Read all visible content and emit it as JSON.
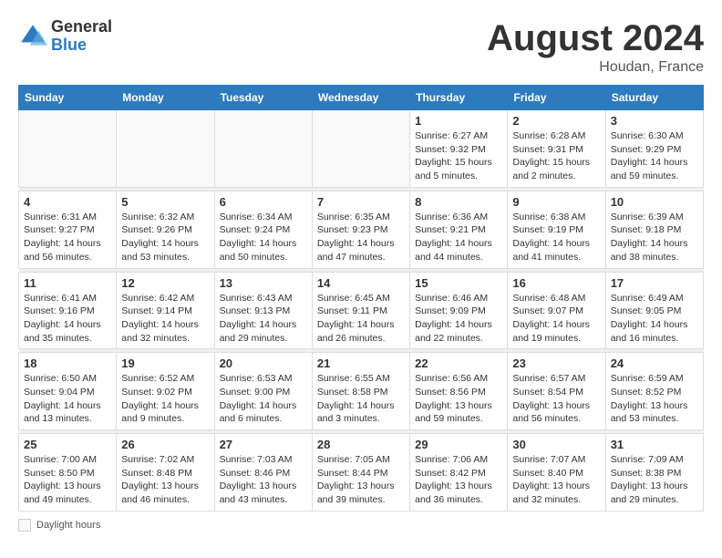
{
  "header": {
    "logo_general": "General",
    "logo_blue": "Blue",
    "title": "August 2024",
    "location": "Houdan, France"
  },
  "days_of_week": [
    "Sunday",
    "Monday",
    "Tuesday",
    "Wednesday",
    "Thursday",
    "Friday",
    "Saturday"
  ],
  "legend": {
    "label": "Daylight hours"
  },
  "weeks": [
    {
      "days": [
        {
          "date": "",
          "info": ""
        },
        {
          "date": "",
          "info": ""
        },
        {
          "date": "",
          "info": ""
        },
        {
          "date": "",
          "info": ""
        },
        {
          "date": "1",
          "info": "Sunrise: 6:27 AM\nSunset: 9:32 PM\nDaylight: 15 hours\nand 5 minutes."
        },
        {
          "date": "2",
          "info": "Sunrise: 6:28 AM\nSunset: 9:31 PM\nDaylight: 15 hours\nand 2 minutes."
        },
        {
          "date": "3",
          "info": "Sunrise: 6:30 AM\nSunset: 9:29 PM\nDaylight: 14 hours\nand 59 minutes."
        }
      ]
    },
    {
      "days": [
        {
          "date": "4",
          "info": "Sunrise: 6:31 AM\nSunset: 9:27 PM\nDaylight: 14 hours\nand 56 minutes."
        },
        {
          "date": "5",
          "info": "Sunrise: 6:32 AM\nSunset: 9:26 PM\nDaylight: 14 hours\nand 53 minutes."
        },
        {
          "date": "6",
          "info": "Sunrise: 6:34 AM\nSunset: 9:24 PM\nDaylight: 14 hours\nand 50 minutes."
        },
        {
          "date": "7",
          "info": "Sunrise: 6:35 AM\nSunset: 9:23 PM\nDaylight: 14 hours\nand 47 minutes."
        },
        {
          "date": "8",
          "info": "Sunrise: 6:36 AM\nSunset: 9:21 PM\nDaylight: 14 hours\nand 44 minutes."
        },
        {
          "date": "9",
          "info": "Sunrise: 6:38 AM\nSunset: 9:19 PM\nDaylight: 14 hours\nand 41 minutes."
        },
        {
          "date": "10",
          "info": "Sunrise: 6:39 AM\nSunset: 9:18 PM\nDaylight: 14 hours\nand 38 minutes."
        }
      ]
    },
    {
      "days": [
        {
          "date": "11",
          "info": "Sunrise: 6:41 AM\nSunset: 9:16 PM\nDaylight: 14 hours\nand 35 minutes."
        },
        {
          "date": "12",
          "info": "Sunrise: 6:42 AM\nSunset: 9:14 PM\nDaylight: 14 hours\nand 32 minutes."
        },
        {
          "date": "13",
          "info": "Sunrise: 6:43 AM\nSunset: 9:13 PM\nDaylight: 14 hours\nand 29 minutes."
        },
        {
          "date": "14",
          "info": "Sunrise: 6:45 AM\nSunset: 9:11 PM\nDaylight: 14 hours\nand 26 minutes."
        },
        {
          "date": "15",
          "info": "Sunrise: 6:46 AM\nSunset: 9:09 PM\nDaylight: 14 hours\nand 22 minutes."
        },
        {
          "date": "16",
          "info": "Sunrise: 6:48 AM\nSunset: 9:07 PM\nDaylight: 14 hours\nand 19 minutes."
        },
        {
          "date": "17",
          "info": "Sunrise: 6:49 AM\nSunset: 9:05 PM\nDaylight: 14 hours\nand 16 minutes."
        }
      ]
    },
    {
      "days": [
        {
          "date": "18",
          "info": "Sunrise: 6:50 AM\nSunset: 9:04 PM\nDaylight: 14 hours\nand 13 minutes."
        },
        {
          "date": "19",
          "info": "Sunrise: 6:52 AM\nSunset: 9:02 PM\nDaylight: 14 hours\nand 9 minutes."
        },
        {
          "date": "20",
          "info": "Sunrise: 6:53 AM\nSunset: 9:00 PM\nDaylight: 14 hours\nand 6 minutes."
        },
        {
          "date": "21",
          "info": "Sunrise: 6:55 AM\nSunset: 8:58 PM\nDaylight: 14 hours\nand 3 minutes."
        },
        {
          "date": "22",
          "info": "Sunrise: 6:56 AM\nSunset: 8:56 PM\nDaylight: 13 hours\nand 59 minutes."
        },
        {
          "date": "23",
          "info": "Sunrise: 6:57 AM\nSunset: 8:54 PM\nDaylight: 13 hours\nand 56 minutes."
        },
        {
          "date": "24",
          "info": "Sunrise: 6:59 AM\nSunset: 8:52 PM\nDaylight: 13 hours\nand 53 minutes."
        }
      ]
    },
    {
      "days": [
        {
          "date": "25",
          "info": "Sunrise: 7:00 AM\nSunset: 8:50 PM\nDaylight: 13 hours\nand 49 minutes."
        },
        {
          "date": "26",
          "info": "Sunrise: 7:02 AM\nSunset: 8:48 PM\nDaylight: 13 hours\nand 46 minutes."
        },
        {
          "date": "27",
          "info": "Sunrise: 7:03 AM\nSunset: 8:46 PM\nDaylight: 13 hours\nand 43 minutes."
        },
        {
          "date": "28",
          "info": "Sunrise: 7:05 AM\nSunset: 8:44 PM\nDaylight: 13 hours\nand 39 minutes."
        },
        {
          "date": "29",
          "info": "Sunrise: 7:06 AM\nSunset: 8:42 PM\nDaylight: 13 hours\nand 36 minutes."
        },
        {
          "date": "30",
          "info": "Sunrise: 7:07 AM\nSunset: 8:40 PM\nDaylight: 13 hours\nand 32 minutes."
        },
        {
          "date": "31",
          "info": "Sunrise: 7:09 AM\nSunset: 8:38 PM\nDaylight: 13 hours\nand 29 minutes."
        }
      ]
    }
  ]
}
